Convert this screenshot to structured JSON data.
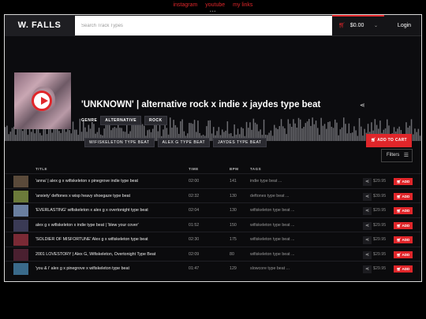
{
  "toplinks": [
    "instagram",
    "youtube",
    "my links"
  ],
  "nav": {
    "logo": "W. FALLS",
    "search_placeholder": "Search Track Types",
    "cart_total": "$0.00",
    "login": "Login"
  },
  "featured": {
    "title": "'UNKNOWN' | alternative rock x indie x jaydes type beat",
    "genre_label": "GENRE",
    "genres": [
      "ALTERNATIVE",
      "ROCK"
    ],
    "tags": [
      "WIFISKELETON TYPE BEAT",
      "ALEX G TYPE BEAT",
      "JAYDES TYPE BEAT"
    ],
    "add_to_cart": "ADD TO CART"
  },
  "filters_label": "Filters",
  "table": {
    "headers": {
      "title": "TITLE",
      "time": "TIME",
      "bpm": "BPM",
      "tags": "TAGS"
    },
    "rows": [
      {
        "title": "'anna' | alex g x wifiskeleton x pinegrove indie type beat",
        "time": "02:00",
        "bpm": "141",
        "tags": "indie type beat ...",
        "price": "$29.95",
        "add": "ADD",
        "thumb": "#5a4a3a"
      },
      {
        "title": "'anxiety' deftones x wisp heavy shoegaze type beat",
        "time": "02:32",
        "bpm": "130",
        "tags": "deftones type beat ...",
        "price": "$39.95",
        "add": "ADD",
        "thumb": "#6b7a3a"
      },
      {
        "title": "'EVERLASTING' wifiskeleton x alex g x overtonight type beat",
        "time": "02:04",
        "bpm": "130",
        "tags": "wifiskeleton type beat ...",
        "price": "$29.95",
        "add": "ADD",
        "thumb": "#6a7fa0"
      },
      {
        "title": "alex g x wifiskeleton x indie type beat | 'blew your cover'",
        "time": "01:52",
        "bpm": "150",
        "tags": "wifiskeleton type beat ...",
        "price": "$29.95",
        "add": "ADD",
        "thumb": "#3a3a55"
      },
      {
        "title": "'SOLDIER OF MISFORTUNE' Alex g x wifiskeleton type beat",
        "time": "02:30",
        "bpm": "175",
        "tags": "wifiskeleton type beat ...",
        "price": "$29.95",
        "add": "ADD",
        "thumb": "#7a2a35"
      },
      {
        "title": "2001 LOVESTORY | Alex G, Wifiskeleton, Overtonight Type Beat",
        "time": "02:09",
        "bpm": "80",
        "tags": "wifiskeleton type beat ...",
        "price": "$29.95",
        "add": "ADD",
        "thumb": "#4a2030"
      },
      {
        "title": "'you & i' alex g x pinegrove x wifiskeleton type beat",
        "time": "01:47",
        "bpm": "129",
        "tags": "slowcore type beat ...",
        "price": "$29.95",
        "add": "ADD",
        "thumb": "#3a6a8a"
      }
    ]
  },
  "colors": {
    "accent": "#e0262a",
    "background": "#0b0b0d"
  }
}
